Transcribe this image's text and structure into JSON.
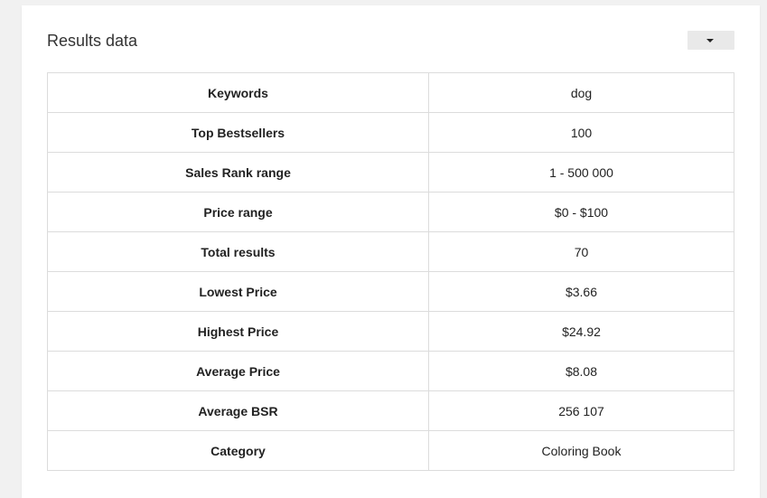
{
  "panel": {
    "title": "Results data",
    "dropdown_icon": "caret-down-icon"
  },
  "results": {
    "rows": [
      {
        "label": "Keywords",
        "value": "dog"
      },
      {
        "label": "Top Bestsellers",
        "value": "100"
      },
      {
        "label": "Sales Rank range",
        "value": "1 - 500 000"
      },
      {
        "label": "Price range",
        "value": "$0 - $100"
      },
      {
        "label": "Total results",
        "value": "70"
      },
      {
        "label": "Lowest Price",
        "value": "$3.66"
      },
      {
        "label": "Highest Price",
        "value": "$24.92"
      },
      {
        "label": "Average Price",
        "value": "$8.08"
      },
      {
        "label": "Average BSR",
        "value": "256 107"
      },
      {
        "label": "Category",
        "value": "Coloring Book"
      }
    ]
  },
  "colors": {
    "background": "#f1f1f1",
    "card": "#ffffff",
    "border": "#dcdcdc",
    "text": "#222222",
    "dropdown": "#e9e9e9"
  }
}
